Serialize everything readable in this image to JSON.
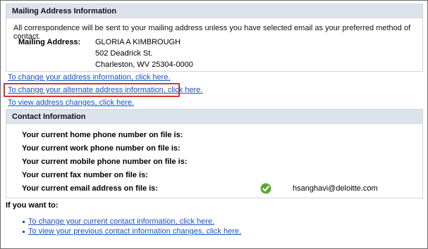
{
  "mailing": {
    "header": "Mailing Address Information",
    "intro": "All correspondence will be sent to your mailing address unless you have selected email as your preferred method of contact.",
    "label": "Mailing Address:",
    "address_lines": [
      "GLORIA A KIMBROUGH",
      "502 Deadrick St.",
      "Charleston, WV 25304-0000"
    ]
  },
  "links": {
    "change_address": "To change your address information, click here.",
    "change_alternate": "To change your alternate address information, click here.",
    "view_changes": "To view address changes, click here."
  },
  "contact": {
    "header": "Contact Information",
    "rows": {
      "home": "Your current home phone number on file is:",
      "work": "Your current work phone number on file is:",
      "mobile": "Your current mobile phone number on file is:",
      "fax": "Your current fax number on file is:",
      "email": "Your current email address on file is:"
    },
    "email_value": "hsanghavi@deloitte.com",
    "email_status_icon": "check-circle-icon",
    "email_status_color": "#5aaa2e"
  },
  "want": {
    "label": "If you want to:",
    "items": [
      "To change your current contact information, click here.",
      "To view your previous contact information changes, click here."
    ]
  },
  "colors": {
    "link": "#1a4fc4",
    "highlight_box": "#d9342b",
    "panel_header_bg": "#dde3ec"
  }
}
